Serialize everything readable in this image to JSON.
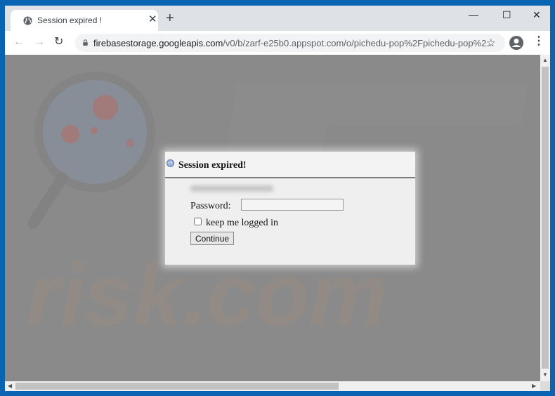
{
  "browser": {
    "tab": {
      "title": "Session expired !",
      "icon": "globe-icon",
      "close_glyph": "✕"
    },
    "new_tab_glyph": "+",
    "window_controls": {
      "minimize": "—",
      "maximize": "☐",
      "close": "✕"
    },
    "nav": {
      "back": "←",
      "forward": "→",
      "reload": "↻"
    },
    "address": {
      "host": "firebasestorage.googleapis.com",
      "path": "/v0/b/zarf-e25b0.appspot.com/o/pichedu-pop%2Fpichedu-pop%2..."
    },
    "bookmark_glyph": "☆",
    "menu_glyph": "⋮"
  },
  "dialog": {
    "title": "Session expired!",
    "email_blurred": "",
    "password_label": "Password:",
    "password_value": "",
    "remember_label": "keep me logged in",
    "remember_checked": false,
    "continue_label": "Continue"
  },
  "watermark": {
    "text": "risk.com"
  },
  "colors": {
    "window_frame": "#0a64b4",
    "tab_strip": "#dee1e6",
    "page_background": "#8a8a8a",
    "dialog_background": "#efefef"
  }
}
